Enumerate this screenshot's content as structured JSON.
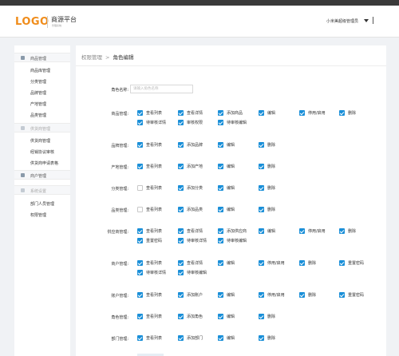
{
  "header": {
    "logo": "LOGO",
    "brand": "商源平台",
    "brand_sub": "管理系统",
    "user": "小米美超级管理员"
  },
  "sidebar": {
    "sections": [
      {
        "title": "商品管理",
        "items": [
          "商品库管理",
          "分类管理",
          "品牌管理",
          "产地管理",
          "品类管理"
        ]
      },
      {
        "title": "供货商管理",
        "items": [
          "供货商管理",
          "经销协议审核",
          "供货商申请表格"
        ]
      },
      {
        "title": "商户管理",
        "items": []
      },
      {
        "title": "系统设置",
        "items": [
          "部门人员管理",
          "权限管理"
        ]
      }
    ]
  },
  "breadcrumb": {
    "parent": "权限管理",
    "separator": ">",
    "current": "角色编辑"
  },
  "form": {
    "role_name_label": "角色名称:",
    "role_name_placeholder": "请输入角色名称",
    "rows": [
      {
        "label": "商品管理:",
        "checks": [
          {
            "text": "查看列表",
            "checked": true
          },
          {
            "text": "查看详情",
            "checked": true
          },
          {
            "text": "添加商品",
            "checked": true
          },
          {
            "text": "编辑",
            "checked": true
          },
          {
            "text": "停用/启用",
            "checked": true
          },
          {
            "text": "删除",
            "checked": true
          },
          {
            "text": "待审核详情",
            "checked": true
          },
          {
            "text": "审核权限",
            "checked": true
          },
          {
            "text": "待审核编辑",
            "checked": true
          }
        ]
      },
      {
        "label": "品牌管理:",
        "checks": [
          {
            "text": "查看列表",
            "checked": true
          },
          {
            "text": "添加品牌",
            "checked": true
          },
          {
            "text": "编辑",
            "checked": true
          },
          {
            "text": "删除",
            "checked": true
          }
        ]
      },
      {
        "label": "产地管理:",
        "checks": [
          {
            "text": "查看列表",
            "checked": true
          },
          {
            "text": "添加产地",
            "checked": true
          },
          {
            "text": "编辑",
            "checked": true
          },
          {
            "text": "删除",
            "checked": true
          }
        ]
      },
      {
        "label": "分类管理:",
        "checks": [
          {
            "text": "查看列表",
            "checked": false
          },
          {
            "text": "添加分类",
            "checked": true
          },
          {
            "text": "编辑",
            "checked": true
          },
          {
            "text": "删除",
            "checked": true
          }
        ]
      },
      {
        "label": "品类管理:",
        "checks": [
          {
            "text": "查看列表",
            "checked": false
          },
          {
            "text": "添加品类",
            "checked": true
          },
          {
            "text": "编辑",
            "checked": true
          },
          {
            "text": "删除",
            "checked": true
          }
        ]
      },
      {
        "label": "供应商管理:",
        "checks": [
          {
            "text": "查看列表",
            "checked": true
          },
          {
            "text": "查看详情",
            "checked": true
          },
          {
            "text": "添加供应商",
            "checked": true
          },
          {
            "text": "编辑",
            "checked": true
          },
          {
            "text": "停用/启用",
            "checked": true
          },
          {
            "text": "删除",
            "checked": true
          },
          {
            "text": "重置密码",
            "checked": true
          },
          {
            "text": "待审核详情",
            "checked": true
          },
          {
            "text": "待审核编辑",
            "checked": true
          }
        ]
      },
      {
        "label": "商户管理:",
        "checks": [
          {
            "text": "查看列表",
            "checked": true
          },
          {
            "text": "查看详情",
            "checked": true
          },
          {
            "text": "编辑",
            "checked": true
          },
          {
            "text": "停用/启用",
            "checked": true
          },
          {
            "text": "删除",
            "checked": true
          },
          {
            "text": "重置密码",
            "checked": true
          },
          {
            "text": "待审核详情",
            "checked": true
          },
          {
            "text": "待审核编辑",
            "checked": true
          }
        ]
      },
      {
        "label": "账户管理:",
        "checks": [
          {
            "text": "查看列表",
            "checked": true
          },
          {
            "text": "添加账户",
            "checked": true
          },
          {
            "text": "编辑",
            "checked": true
          },
          {
            "text": "停用/启用",
            "checked": true
          },
          {
            "text": "删除",
            "checked": true
          },
          {
            "text": "重置密码",
            "checked": true
          }
        ]
      },
      {
        "label": "角色管理:",
        "checks": [
          {
            "text": "查看列表",
            "checked": true
          },
          {
            "text": "添加角色",
            "checked": true
          },
          {
            "text": "编辑",
            "checked": true
          },
          {
            "text": "删除",
            "checked": true
          }
        ]
      },
      {
        "label": "部门管理:",
        "checks": [
          {
            "text": "查看列表",
            "checked": true
          },
          {
            "text": "添加部门",
            "checked": true
          },
          {
            "text": "编辑",
            "checked": true
          },
          {
            "text": "删除",
            "checked": true
          }
        ]
      }
    ]
  },
  "colors": {
    "accent": "#1a8fd8",
    "logo": "#f08c1a"
  }
}
